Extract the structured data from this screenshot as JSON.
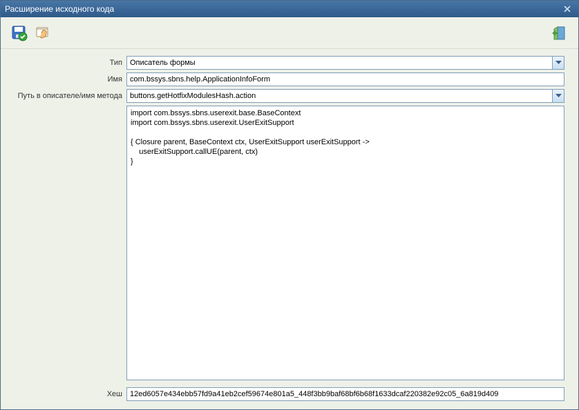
{
  "window": {
    "title": "Расширение исходного кода"
  },
  "toolbar": {
    "save_icon": "save-check",
    "open_icon": "open-hand",
    "exit_icon": "exit-door"
  },
  "form": {
    "type": {
      "label": "Тип",
      "value": "Описатель формы"
    },
    "name": {
      "label": "Имя",
      "value": "com.bssys.sbns.help.ApplicationInfoForm"
    },
    "path": {
      "label": "Путь в описателе/имя метода",
      "value": "buttons.getHotfixModulesHash.action"
    },
    "code": {
      "value": "import com.bssys.sbns.userexit.base.BaseContext\nimport com.bssys.sbns.userexit.UserExitSupport\n\n{ Closure parent, BaseContext ctx, UserExitSupport userExitSupport ->\n    userExitSupport.callUE(parent, ctx)\n}"
    },
    "hash": {
      "label": "Хеш",
      "value": "12ed6057e434ebb57fd9a41eb2cef59674e801a5_448f3bb9baf68bf6b68f1633dcaf220382e92c05_6a819d409"
    }
  }
}
